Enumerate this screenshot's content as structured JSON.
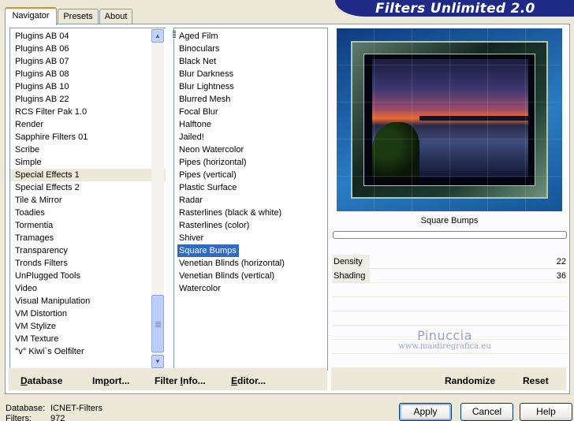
{
  "header": {
    "title": "Filters Unlimited 2.0"
  },
  "tabs": [
    {
      "label": "Navigator",
      "active": true
    },
    {
      "label": "Presets",
      "active": false
    },
    {
      "label": "About",
      "active": false
    }
  ],
  "categories": {
    "items": [
      "Plugins AB 04",
      "Plugins AB 06",
      "Plugins AB 07",
      "Plugins AB 08",
      "Plugins AB 10",
      "Plugins AB 22",
      "RCS Filter Pak 1.0",
      "Render",
      "Sapphire Filters 01",
      "Scribe",
      "Simple",
      "Special Effects 1",
      "Special Effects 2",
      "Tile & Mirror",
      "Toadies",
      "Tormentia",
      "Tramages",
      "Transparency",
      "Tronds Filters",
      "UnPlugged Tools",
      "Video",
      "Visual Manipulation",
      "VM Distortion",
      "VM Stylize",
      "VM Texture",
      "°v° Kiwi`s Oelfilter"
    ],
    "selected": "Special Effects 1"
  },
  "filters": {
    "items": [
      "Aged Film",
      "Binoculars",
      "Black Net",
      "Blur Darkness",
      "Blur Lightness",
      "Blurred Mesh",
      "Focal Blur",
      "Halftone",
      "Jailed!",
      "Neon Watercolor",
      "Pipes (horizontal)",
      "Pipes (vertical)",
      "Plastic Surface",
      "Radar",
      "Rasterlines (black & white)",
      "Rasterlines (color)",
      "Shiver",
      "Square Bumps",
      "Venetian Blinds (horizontal)",
      "Venetian Blinds (vertical)",
      "Watercolor"
    ],
    "selected": "Square Bumps"
  },
  "preview": {
    "filter_name": "Square Bumps"
  },
  "params": [
    {
      "label": "Density",
      "value": "22",
      "fraction": 0.16
    },
    {
      "label": "Shading",
      "value": "36",
      "fraction": 0.16
    }
  ],
  "watermark": {
    "line1": "Pinuccia",
    "line2": "www.maidiregrafica.eu"
  },
  "buttons": {
    "database": {
      "pre": "",
      "u": "D",
      "post": "atabase"
    },
    "import": {
      "pre": "Im",
      "u": "p",
      "post": "ort..."
    },
    "filter_info": {
      "pre": "Filter ",
      "u": "I",
      "post": "nfo..."
    },
    "editor": {
      "pre": "",
      "u": "E",
      "post": "ditor..."
    },
    "randomize": "Randomize",
    "reset": "Reset",
    "apply": "Apply",
    "cancel": "Cancel",
    "help": "Help"
  },
  "status": {
    "database_label": "Database:",
    "database_value": "ICNET-Filters",
    "filters_label": "Filters:",
    "filters_value": "972"
  },
  "colors": {
    "banner": "#1e2a86",
    "selection": "#316ac5",
    "panel": "#ece9d8"
  },
  "icons": {
    "scroll_up": "chevron-up-icon",
    "scroll_down": "chevron-down-icon"
  }
}
